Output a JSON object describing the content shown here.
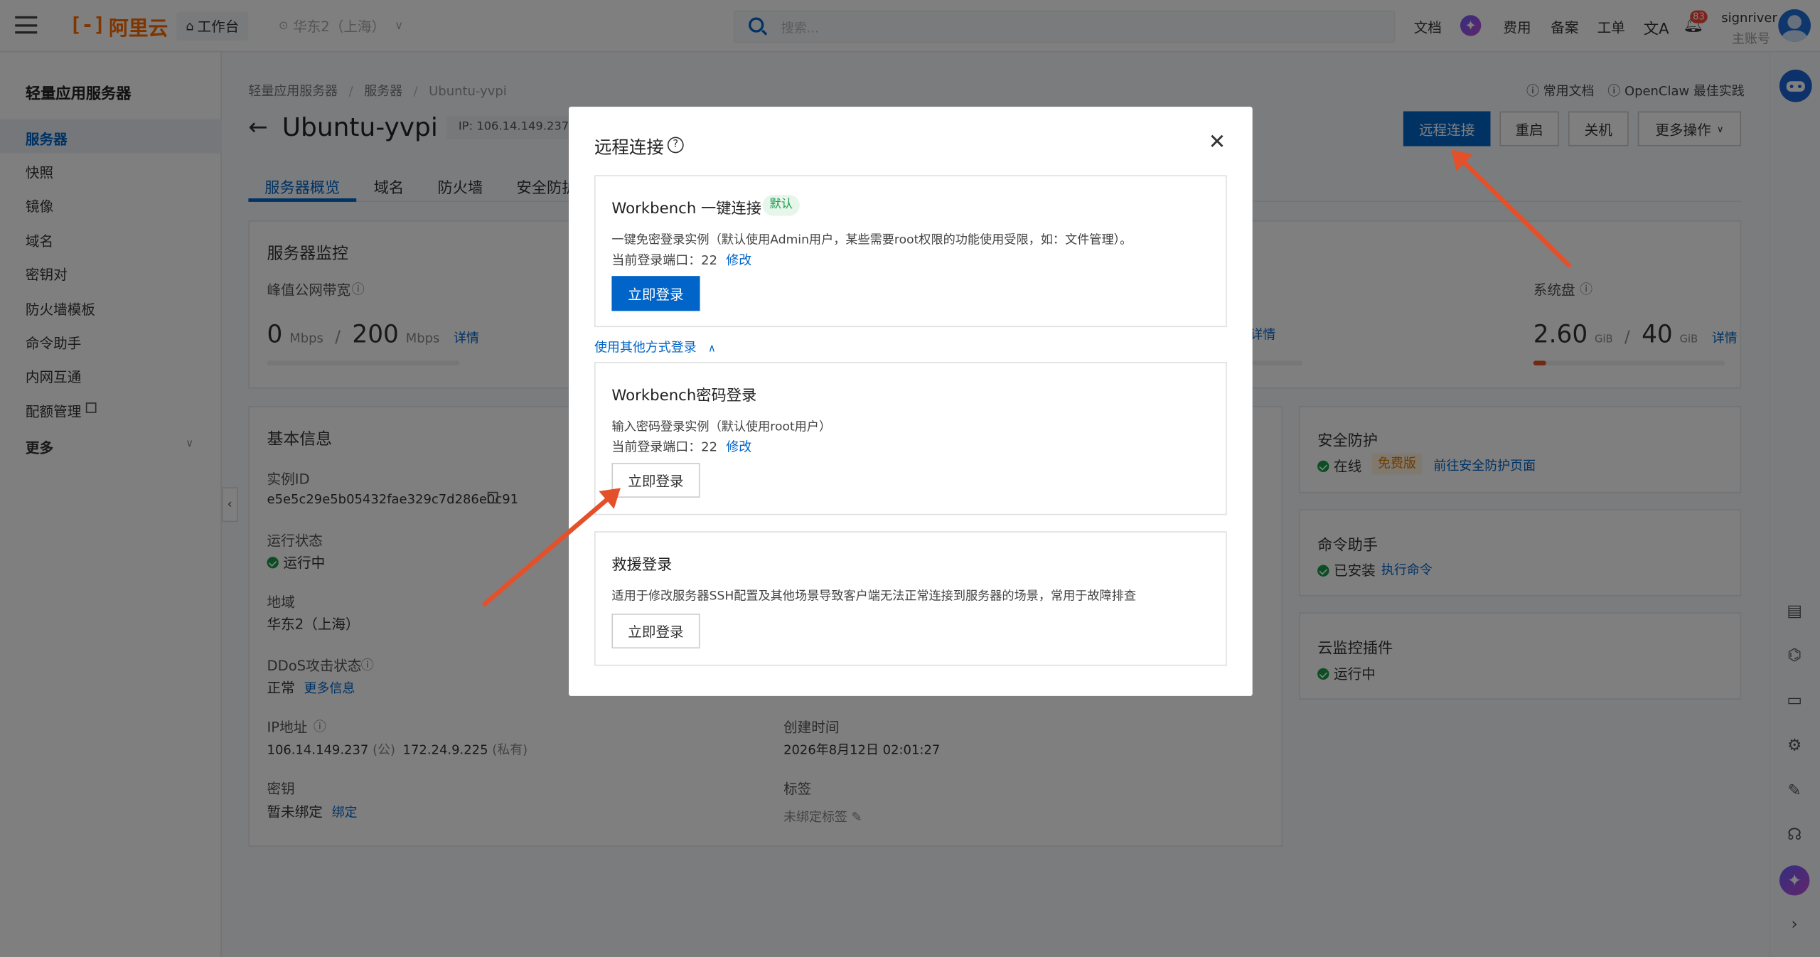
{
  "topbar": {
    "logo_text": "阿里云",
    "workbench": "工作台",
    "region": "华东2（上海）",
    "search_placeholder": "搜索...",
    "links": [
      "文档",
      "费用",
      "备案",
      "工单"
    ],
    "notification_count": "83",
    "user_name": "signriver",
    "user_role": "主账号"
  },
  "sidebar": {
    "title": "轻量应用服务器",
    "items": [
      "服务器",
      "快照",
      "镜像",
      "域名",
      "密钥对",
      "防火墙模板",
      "命令助手",
      "内网互通",
      "配额管理"
    ],
    "more": "更多"
  },
  "header": {
    "breadcrumb": [
      "轻量应用服务器",
      "服务器",
      "Ubuntu-yvpi"
    ],
    "title": "Ubuntu-yvpi",
    "ip_badge": "IP: 106.14.149.237",
    "help_links": [
      "常用文档",
      "OpenClaw 最佳实践"
    ],
    "actions": {
      "remote": "远程连接",
      "restart": "重启",
      "shutdown": "关机",
      "more": "更多操作"
    },
    "tabs": [
      "服务器概览",
      "域名",
      "防火墙",
      "安全防护"
    ]
  },
  "monitor": {
    "title": "服务器监控",
    "bandwidth_label": "峰值公网带宽",
    "bandwidth_used": "0",
    "bandwidth_total": "200",
    "bandwidth_unit": "Mbps",
    "detail": "详情",
    "disk_label": "系统盘",
    "disk_used": "2.60",
    "disk_total": "40",
    "disk_unit": "GiB",
    "disk_fraction": 0.065
  },
  "basic": {
    "title": "基本信息",
    "instance_id_label": "实例ID",
    "instance_id": "e5e5c29e5b05432fae329c7d286e0c91",
    "status_label": "运行状态",
    "status": "运行中",
    "region_label": "地域",
    "region": "华东2（上海）",
    "ddos_label": "DDoS攻击状态",
    "ddos": "正常",
    "ddos_more": "更多信息",
    "ip_label": "IP地址",
    "public_ip": "106.14.149.237",
    "public_tag": "(公)",
    "private_ip": "172.24.9.225",
    "private_tag": "(私有)",
    "key_label": "密钥",
    "key": "暂未绑定",
    "key_bind": "绑定",
    "created_label": "创建时间",
    "created": "2026年8月12日 02:01:27",
    "tag_label": "标签",
    "tag": "未绑定标签"
  },
  "right_cards": {
    "security_title": "安全防护",
    "security_status": "在线",
    "security_badge": "免费版",
    "security_link": "前往安全防护页面",
    "cmd_title": "命令助手",
    "cmd_status": "已安装",
    "cmd_link": "执行命令",
    "mon_title": "云监控插件",
    "mon_status": "运行中"
  },
  "modal": {
    "title": "远程连接",
    "workbench_title": "Workbench 一键连接",
    "default_badge": "默认",
    "workbench_desc": "一键免密登录实例（默认使用Admin用户，某些需要root权限的功能使用受限，如：文件管理）。",
    "port_label": "当前登录端口：22",
    "modify": "修改",
    "login_now": "立即登录",
    "other_methods": "使用其他方式登录",
    "pwd_title": "Workbench密码登录",
    "pwd_desc": "输入密码登录实例（默认使用root用户）",
    "rescue_title": "救援登录",
    "rescue_desc": "适用于修改服务器SSH配置及其他场景导致客户端无法正常连接到服务器的场景，常用于故障排查"
  }
}
